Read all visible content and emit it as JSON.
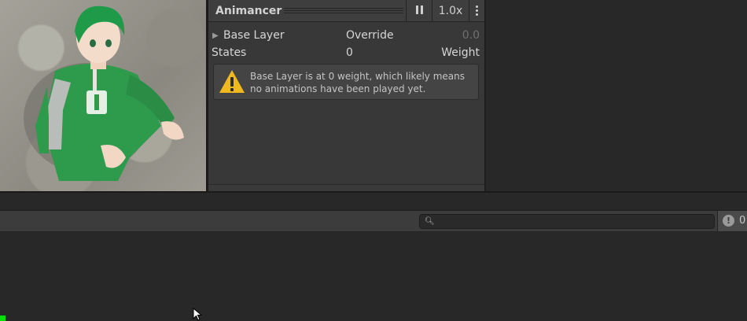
{
  "animancer": {
    "title": "Animancer",
    "speed": "1.0x",
    "layer": {
      "name": "Base Layer",
      "mode": "Override",
      "weight": "0.0"
    },
    "states": {
      "label": "States",
      "count": "0",
      "weight_label": "Weight"
    },
    "warning": "Base Layer is at 0 weight, which likely means no animations have been played yet."
  },
  "console": {
    "search_placeholder": "",
    "error_count": "0"
  },
  "icons": {
    "pause": "pause-icon",
    "menu": "kebab-menu-icon",
    "foldout": "triangle-right-icon",
    "warning": "warning-icon",
    "search": "search-icon",
    "error": "error-icon",
    "cursor": "mouse-cursor-icon"
  },
  "colors": {
    "panel_bg": "#383838",
    "editor_bg": "#282828",
    "warning_yellow": "#f0b820",
    "character_green": "#2e9a4c",
    "status_green": "#00e000"
  }
}
